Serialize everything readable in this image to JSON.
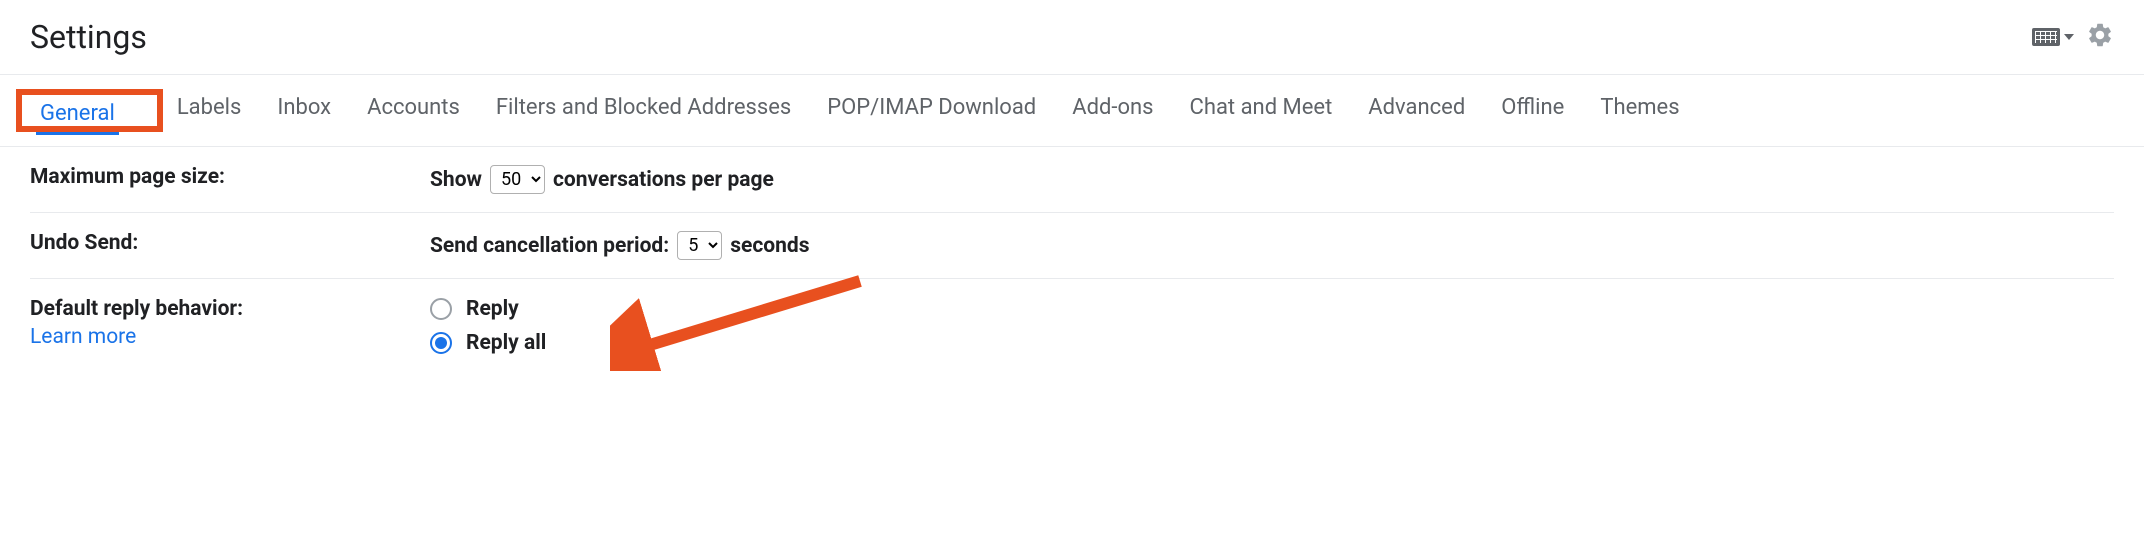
{
  "header": {
    "title": "Settings"
  },
  "tabs": {
    "items": [
      {
        "label": "General",
        "active": true
      },
      {
        "label": "Labels",
        "active": false
      },
      {
        "label": "Inbox",
        "active": false
      },
      {
        "label": "Accounts",
        "active": false
      },
      {
        "label": "Filters and Blocked Addresses",
        "active": false
      },
      {
        "label": "POP/IMAP Download",
        "active": false
      },
      {
        "label": "Add-ons",
        "active": false
      },
      {
        "label": "Chat and Meet",
        "active": false
      },
      {
        "label": "Advanced",
        "active": false
      },
      {
        "label": "Offline",
        "active": false
      },
      {
        "label": "Themes",
        "active": false
      }
    ]
  },
  "settings": {
    "page_size": {
      "label": "Maximum page size:",
      "prefix": "Show",
      "value": "50",
      "suffix": "conversations per page"
    },
    "undo_send": {
      "label": "Undo Send:",
      "prefix": "Send cancellation period:",
      "value": "5",
      "suffix": "seconds"
    },
    "reply_behavior": {
      "label": "Default reply behavior:",
      "learn_more": "Learn more",
      "options": {
        "reply": "Reply",
        "reply_all": "Reply all"
      },
      "selected": "reply_all"
    }
  },
  "annotation": {
    "highlight_color": "#e8501f"
  }
}
